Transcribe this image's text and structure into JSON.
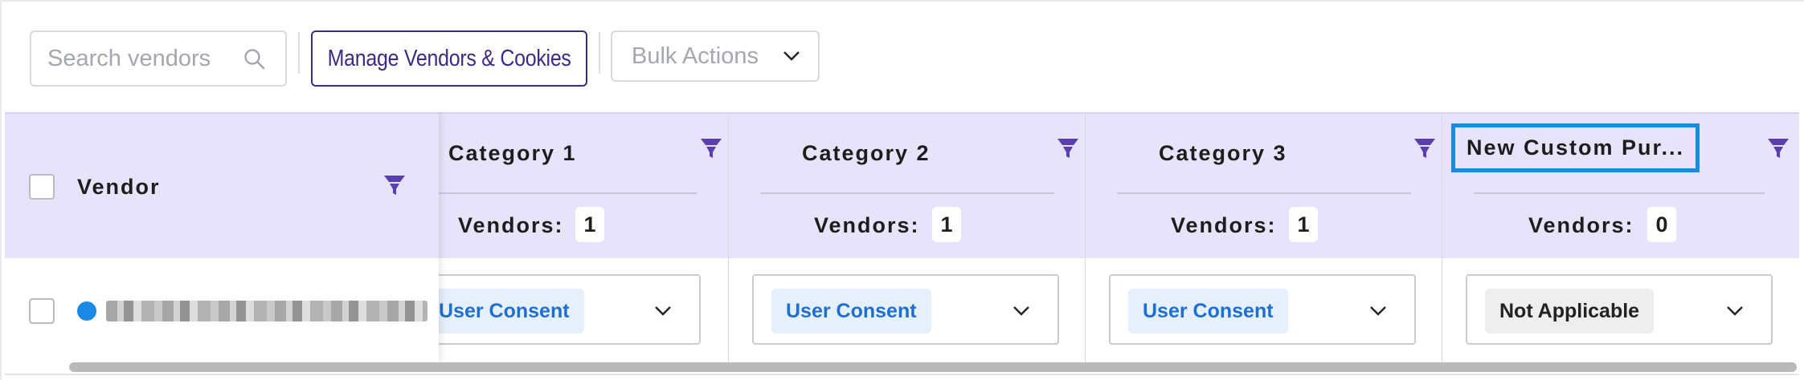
{
  "toolbar": {
    "search_placeholder": "Search vendors",
    "manage_label": "Manage Vendors & Cookies",
    "bulk_label": "Bulk Actions"
  },
  "table": {
    "vendor_header": "Vendor",
    "vendors_label": "Vendors:",
    "categories": [
      {
        "title": "Category 1",
        "vendor_count": "1",
        "selection": "User Consent",
        "selection_type": "consent"
      },
      {
        "title": "Category 2",
        "vendor_count": "1",
        "selection": "User Consent",
        "selection_type": "consent"
      },
      {
        "title": "Category 3",
        "vendor_count": "1",
        "selection": "User Consent",
        "selection_type": "consent"
      },
      {
        "title": "New Custom Pur...",
        "vendor_count": "0",
        "selection": "Not Applicable",
        "selection_type": "na"
      }
    ],
    "row": {
      "status_color": "#1a8ae6",
      "vendor_name_redacted": true
    }
  },
  "colors": {
    "header_bg": "#e7e3fb",
    "accent_purple": "#3e2a86",
    "funnel_purple": "#5a3fb0",
    "consent_blue": "#1e6fd1",
    "selected_outline": "#1a8ae6"
  },
  "icons": [
    "search-icon",
    "chevron-down-icon",
    "filter-funnel-icon"
  ]
}
